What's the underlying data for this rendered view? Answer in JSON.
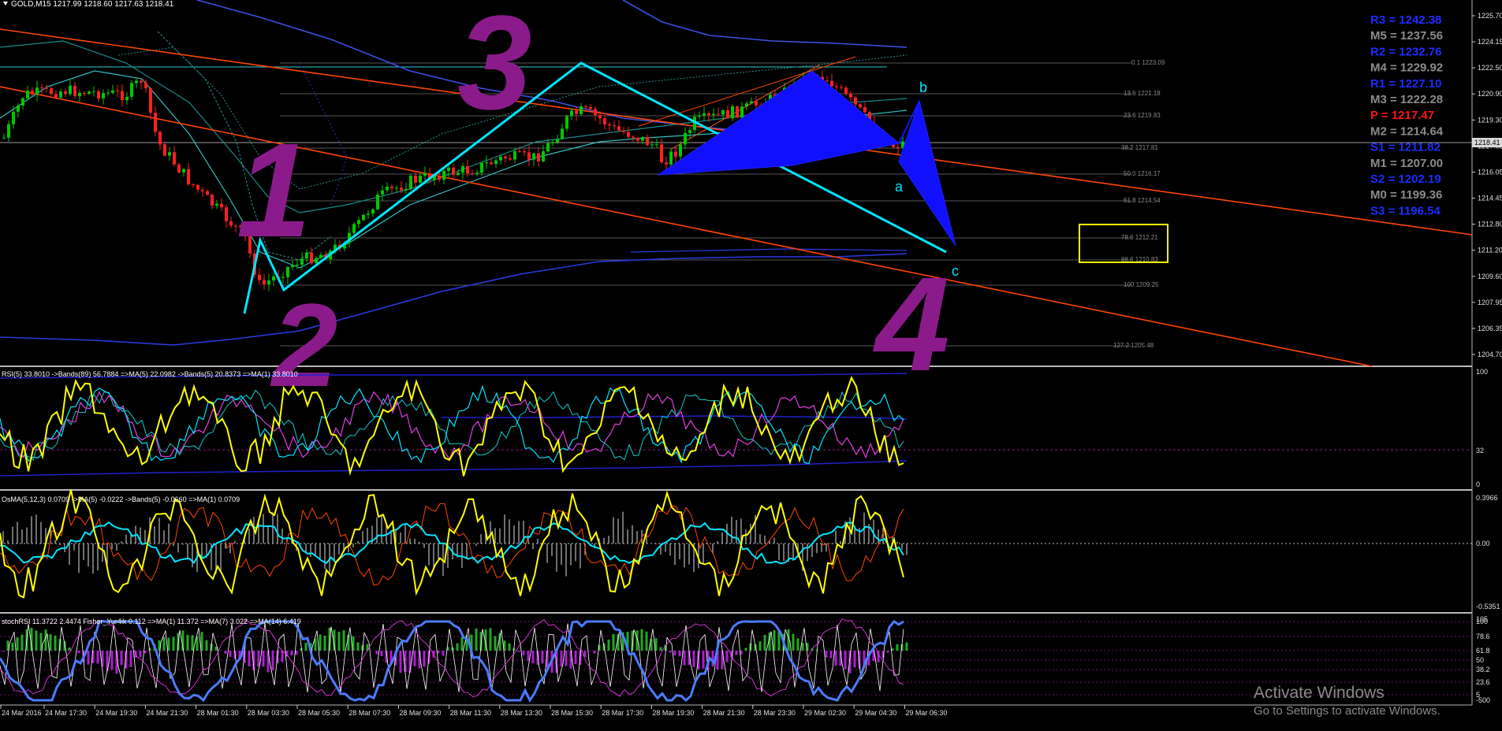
{
  "symbol_header": "GOLD,M15  1217.99 1218.60 1217.63 1218.41",
  "current_price_tag": "1218.41",
  "price_axis": [
    "1225.70",
    "1224.15",
    "1222.50",
    "1220.90",
    "1219.30",
    "1217.65",
    "1216.05",
    "1214.45",
    "1212.80",
    "1211.20",
    "1209.60",
    "1207.95",
    "1206.35",
    "1204.70"
  ],
  "pivots": [
    {
      "label": "R3 = 1242.38",
      "color": "#1e2cff"
    },
    {
      "label": "M5 = 1237.56",
      "color": "#8c8c8c"
    },
    {
      "label": "R2 = 1232.76",
      "color": "#1e2cff"
    },
    {
      "label": "M4 = 1229.92",
      "color": "#8c8c8c"
    },
    {
      "label": "R1 = 1227.10",
      "color": "#1e2cff"
    },
    {
      "label": "M3 = 1222.28",
      "color": "#8c8c8c"
    },
    {
      "label": "P   = 1217.47",
      "color": "#ff1414"
    },
    {
      "label": "M2 = 1214.64",
      "color": "#8c8c8c"
    },
    {
      "label": "S1 = 1211.82",
      "color": "#1e2cff"
    },
    {
      "label": "M1 = 1207.00",
      "color": "#8c8c8c"
    },
    {
      "label": "S2 = 1202.19",
      "color": "#1e2cff"
    },
    {
      "label": "M0 = 1199.36",
      "color": "#8c8c8c"
    },
    {
      "label": "S3 = 1196.54",
      "color": "#1e2cff"
    }
  ],
  "fib_levels": [
    "0.1 1223.09",
    "13.6 1221.18",
    "23.6 1219.83",
    "38.2 1217.81",
    "50.0 1216.17",
    "61.8 1214.54",
    "78.6 1212.21",
    "88.6 1210.83",
    "100 1209.25",
    "127.2 1205.48"
  ],
  "wave_labels": [
    "1",
    "2",
    "3",
    "4"
  ],
  "pattern_labels": [
    "a",
    "b",
    "c"
  ],
  "rsi": {
    "header": "RSI(5) 33.8010  ->Bands(89) 56.7884  =>MA(5) 22.0982  ->Bands(5) 20.8373  =>MA(1) 33.8010",
    "scale": [
      "100",
      "32",
      "0"
    ]
  },
  "osma": {
    "header": "OsMA(5,12,3) 0.0709  ->MA(5) -0.0222  ->Bands(5) -0.0660  =>MA(1) 0.0709",
    "scale": [
      "0.3966",
      "0.00",
      "-0.5351"
    ]
  },
  "stoch": {
    "header": "stochRSI 11.3722 2.4474  Fisher_Yur4ik  0.112  =>MA(1) 11.372  =>MA(7) 3.022  =>MA(14) 6.419",
    "scale": [
      "105",
      "100",
      "78.6",
      "61.8",
      "50",
      "38.2",
      "23.6",
      "5",
      "-500"
    ]
  },
  "time_axis": [
    "24 Mar 2016",
    "24 Mar 17:30",
    "24 Mar 19:30",
    "24 Mar 21:30",
    "28 Mar 01:30",
    "28 Mar 03:30",
    "28 Mar 05:30",
    "28 Mar 07:30",
    "28 Mar 09:30",
    "28 Mar 11:30",
    "28 Mar 13:30",
    "28 Mar 15:30",
    "28 Mar 17:30",
    "28 Mar 19:30",
    "28 Mar 21:30",
    "28 Mar 23:30",
    "29 Mar 02:30",
    "29 Mar 04:30",
    "29 Mar 06:30"
  ],
  "watermark": {
    "title": "Activate Windows",
    "subtitle": "Go to Settings to activate Windows."
  },
  "colors": {
    "cyan": "#00e5ff",
    "magenta": "#8b1a8b",
    "orange": "#ff4500",
    "blue_pattern": "#1010ff",
    "yellow": "#ffff00",
    "bull": "#00c800",
    "bear": "#ff2020"
  }
}
